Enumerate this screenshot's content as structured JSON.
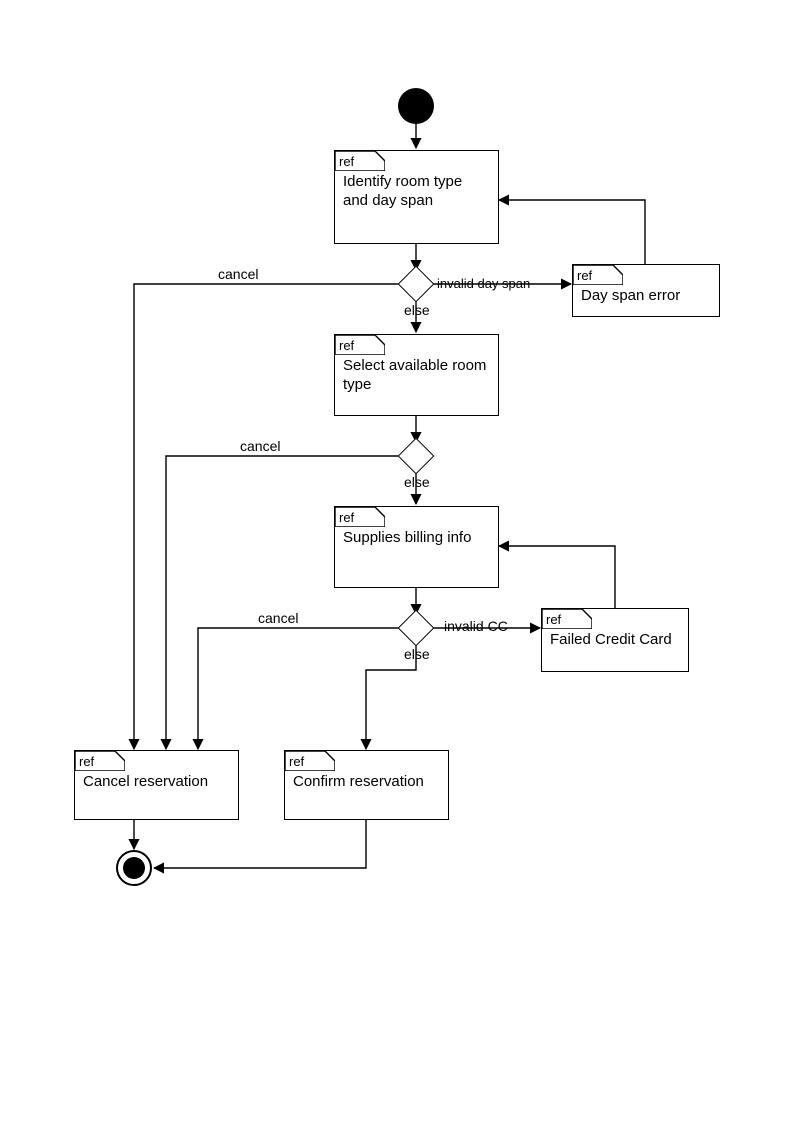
{
  "tab_label": "ref",
  "nodes": {
    "identify": "Identify room type and day span",
    "dayspan_error": "Day span error",
    "select_room": "Select available room type",
    "billing": "Supplies billing info",
    "failed_cc": "Failed Credit Card",
    "cancel_res": "Cancel reservation",
    "confirm_res": "Confirm reservation"
  },
  "edges": {
    "cancel": "cancel",
    "else": "else",
    "invalid_day_span": "invalid day span",
    "invalid_cc": "invalid CC"
  }
}
